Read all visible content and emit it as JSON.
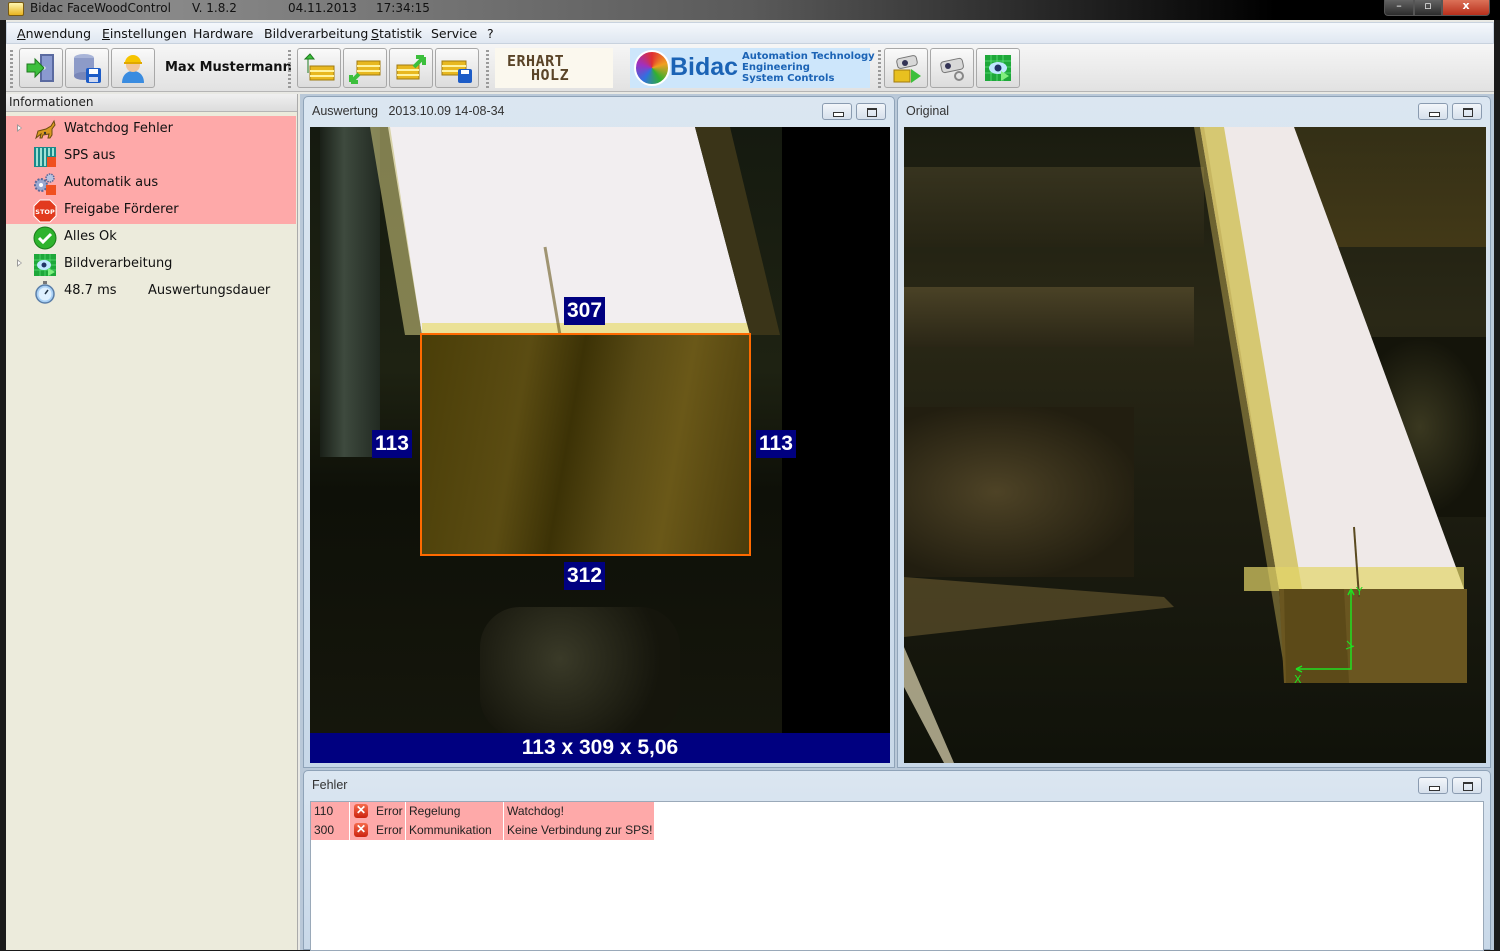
{
  "window": {
    "app_name": "Bidac FaceWoodControl",
    "version": "V. 1.8.2",
    "date": "04.11.2013",
    "time": "17:34:15",
    "controls": {
      "minimize": "–",
      "maximize": "▫",
      "close": "x"
    }
  },
  "menu": [
    {
      "label": "Anwendung",
      "mnemonic": "A",
      "rest": "nwendung"
    },
    {
      "label": "Einstellungen",
      "mnemonic": "E",
      "rest": "instellungen"
    },
    {
      "label": "Hardware"
    },
    {
      "label": "Bildverarbeitung"
    },
    {
      "label": "Statistik",
      "mnemonic": "S",
      "rest": "tatistik"
    },
    {
      "label": "Service"
    },
    {
      "label": "?"
    }
  ],
  "toolbar": {
    "user_name": "Max Mustermann",
    "buttons_left": [
      "logout-icon",
      "database-save-icon",
      "user-icon"
    ],
    "buttons_mid": [
      "import-icon",
      "transfer-icon",
      "export-icon",
      "save-list-icon"
    ],
    "buttons_right": [
      "camera-play-icon",
      "camera-settings-icon",
      "image-processing-icon"
    ],
    "customer_logo": {
      "line1": "ERHART",
      "line2": "HOLZ"
    },
    "vendor_logo": {
      "brand": "Bidac",
      "lines": [
        "Automation Technology",
        "Engineering",
        "System Controls"
      ]
    }
  },
  "info_panel": {
    "title": "Informationen",
    "items": [
      {
        "label": "Watchdog Fehler",
        "icon": "watchdog-icon",
        "state": "error",
        "expandable": true
      },
      {
        "label": "SPS aus",
        "icon": "plc-icon",
        "state": "error",
        "expandable": false
      },
      {
        "label": "Automatik aus",
        "icon": "gears-icon",
        "state": "error",
        "expandable": false
      },
      {
        "label": "Freigabe Förderer",
        "icon": "stop-sign-icon",
        "state": "error",
        "expandable": false
      },
      {
        "label": "Alles Ok",
        "icon": "check-icon",
        "state": "ok",
        "expandable": false
      },
      {
        "label": "Bildverarbeitung",
        "icon": "image-processing-icon",
        "state": "normal",
        "expandable": true
      },
      {
        "label": "48.7 ms",
        "label2": "Auswertungsdauer",
        "icon": "stopwatch-icon",
        "state": "normal",
        "expandable": false
      }
    ]
  },
  "auswertung": {
    "title": "Auswertung",
    "timestamp": "2013.10.09 14-08-34",
    "measurements": {
      "top": "307",
      "bottom": "312",
      "left": "113",
      "right": "113"
    },
    "result": "113 x 309 x 5,06"
  },
  "original": {
    "title": "Original",
    "axis_labels": {
      "x": "X",
      "y": "Y"
    }
  },
  "fehler": {
    "title": "Fehler",
    "rows": [
      {
        "code": "110",
        "type": "Error",
        "category": "Regelung",
        "message": "Watchdog!"
      },
      {
        "code": "300",
        "type": "Error",
        "category": "Kommunikation",
        "message": "Keine Verbindung zur SPS!"
      }
    ]
  },
  "colors": {
    "error_row": "#fea9a9",
    "measure_label_bg": "#000080",
    "roi_border": "#ff6a00",
    "axis_marker": "#20e020"
  }
}
